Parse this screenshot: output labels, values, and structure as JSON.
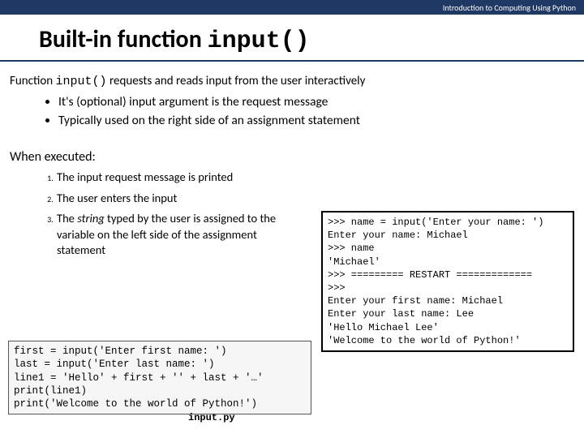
{
  "header": "Introduction to Computing Using Python",
  "title_plain": "Built-in function ",
  "title_code": "input()",
  "intro_pre": "Function ",
  "intro_code": "input()",
  "intro_post": " requests and reads input from the user interactively",
  "bullets": {
    "b1": "It's (optional) input argument is the request message",
    "b2": "Typically used on the right side of an assignment statement"
  },
  "when_label": "When executed:",
  "steps": {
    "s1": "The input request message is printed",
    "s2": "The user enters the input",
    "s3a": "The ",
    "s3b": "string",
    "s3c": " typed by the user is assigned to the variable on the left side of the assignment statement"
  },
  "shell": ">>> name = input('Enter your name: ')\nEnter your name: Michael\n>>> name\n'Michael'\n>>> ========= RESTART =============\n>>> \nEnter your first name: Michael\nEnter your last name: Lee\n'Hello Michael Lee'\n'Welcome to the world of Python!'",
  "src": "first = input('Enter first name: ')\nlast = input('Enter last name: ')\nline1 = 'Hello' + first + '' + last + '…'\nprint(line1)\nprint('Welcome to the world of Python!')",
  "src_caption": "input.py"
}
